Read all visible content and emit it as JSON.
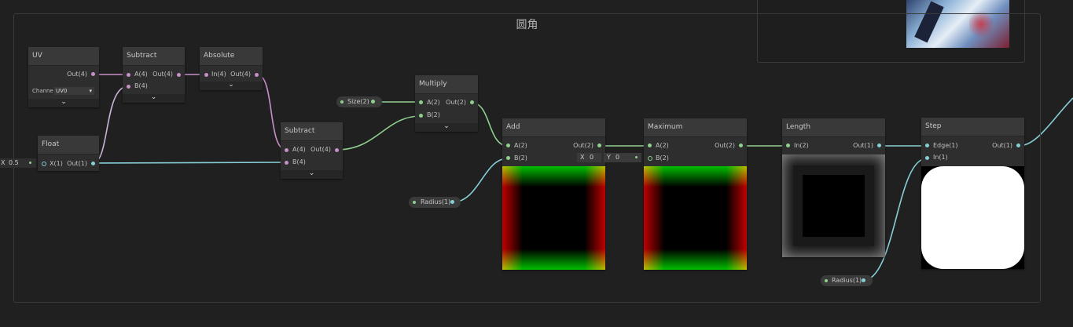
{
  "group": {
    "title": "圆角"
  },
  "nodes": {
    "uv": {
      "title": "UV",
      "out": "Out(4)",
      "channel_label": "Channe",
      "channel_value": "UV0"
    },
    "subtract1": {
      "title": "Subtract",
      "in_a": "A(4)",
      "in_b": "B(4)",
      "out": "Out(4)"
    },
    "absolute": {
      "title": "Absolute",
      "in": "In(4)",
      "out": "Out(4)"
    },
    "float": {
      "title": "Float",
      "in": "X(1)",
      "out": "Out(1)",
      "field_label": "X",
      "field_value": "0.5"
    },
    "subtract2": {
      "title": "Subtract",
      "in_a": "A(4)",
      "in_b": "B(4)",
      "out": "Out(4)"
    },
    "multiply": {
      "title": "Multiply",
      "in_a": "A(2)",
      "in_b": "B(2)",
      "out": "Out(2)"
    },
    "add": {
      "title": "Add",
      "in_a": "A(2)",
      "in_b": "B(2)",
      "out": "Out(2)"
    },
    "maximum": {
      "title": "Maximum",
      "in_a": "A(2)",
      "in_b": "B(2)",
      "out": "Out(2)",
      "field_x_label": "X",
      "field_x_value": "0",
      "field_y_label": "Y",
      "field_y_value": "0"
    },
    "length": {
      "title": "Length",
      "in": "In(2)",
      "out": "Out(1)"
    },
    "step": {
      "title": "Step",
      "in_edge": "Edge(1)",
      "in_in": "In(1)",
      "out": "Out(1)"
    }
  },
  "properties": {
    "size": "Size(2)",
    "radius1": "Radius(1)",
    "radius2": "Radius(1)"
  },
  "colors": {
    "vec4": "#c88fc8",
    "vec2": "#8fd08f",
    "vec1": "#86cfd6",
    "background": "#202020"
  }
}
